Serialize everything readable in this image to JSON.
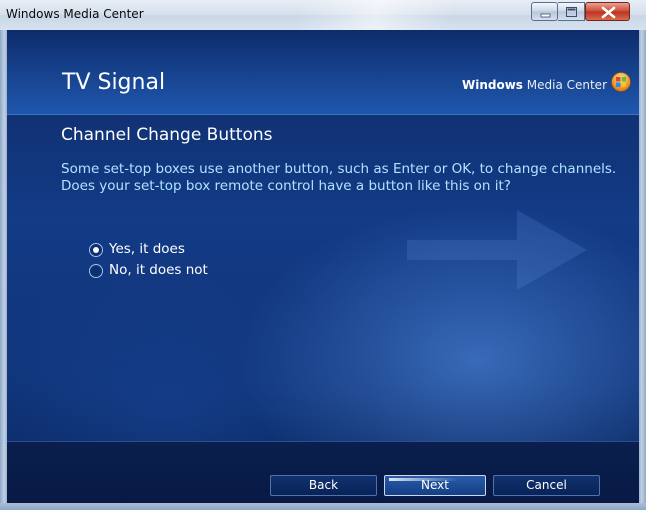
{
  "window": {
    "title": "Windows Media Center",
    "controls": {
      "minimize": "minimize-icon",
      "maximize": "maximize-icon",
      "close": "close-icon"
    }
  },
  "header": {
    "title": "TV Signal",
    "brand_bold": "Windows",
    "brand_light": " Media Center",
    "brand_icon": "windows-orb-icon"
  },
  "page": {
    "subtitle": "Channel Change Buttons",
    "question": "Some set-top boxes use another button, such as Enter or OK, to change channels. Does your set-top box remote control have a button like this on it?",
    "options": [
      {
        "label": "Yes, it does",
        "selected": true
      },
      {
        "label": "No, it does not",
        "selected": false
      }
    ]
  },
  "footer": {
    "back_label": "Back",
    "next_label": "Next",
    "cancel_label": "Cancel"
  },
  "colors": {
    "background": "#133b86",
    "question_text": "#aee4ff",
    "text": "#ffffff",
    "close_button": "#cc4a35"
  }
}
